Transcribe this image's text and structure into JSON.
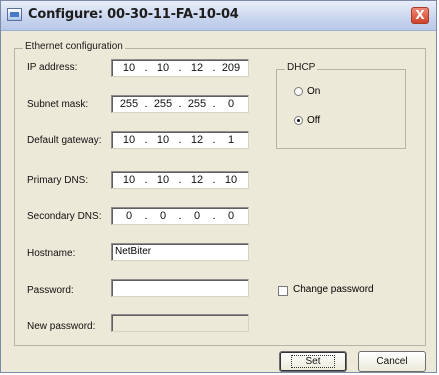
{
  "window": {
    "title": "Configure: 00-30-11-FA-10-04",
    "close_label": "X"
  },
  "ethernet_group": {
    "label": "Ethernet configuration",
    "fields": {
      "ip": {
        "label": "IP address:",
        "octets": [
          "10",
          "10",
          "12",
          "209"
        ]
      },
      "subnet": {
        "label": "Subnet mask:",
        "octets": [
          "255",
          "255",
          "255",
          "0"
        ]
      },
      "gateway": {
        "label": "Default gateway:",
        "octets": [
          "10",
          "10",
          "12",
          "1"
        ]
      },
      "primary_dns": {
        "label": "Primary DNS:",
        "octets": [
          "10",
          "10",
          "12",
          "10"
        ]
      },
      "secondary_dns": {
        "label": "Secondary DNS:",
        "octets": [
          "0",
          "0",
          "0",
          "0"
        ]
      },
      "hostname": {
        "label": "Hostname:",
        "value": "NetBiter"
      },
      "password": {
        "label": "Password:",
        "value": ""
      },
      "new_password": {
        "label": "New password:",
        "value": ""
      }
    }
  },
  "dhcp_group": {
    "label": "DHCP",
    "options": [
      {
        "label": "On",
        "selected": false
      },
      {
        "label": "Off",
        "selected": true
      }
    ]
  },
  "change_password": {
    "label": "Change password",
    "checked": false
  },
  "buttons": {
    "set": "Set",
    "cancel": "Cancel"
  }
}
